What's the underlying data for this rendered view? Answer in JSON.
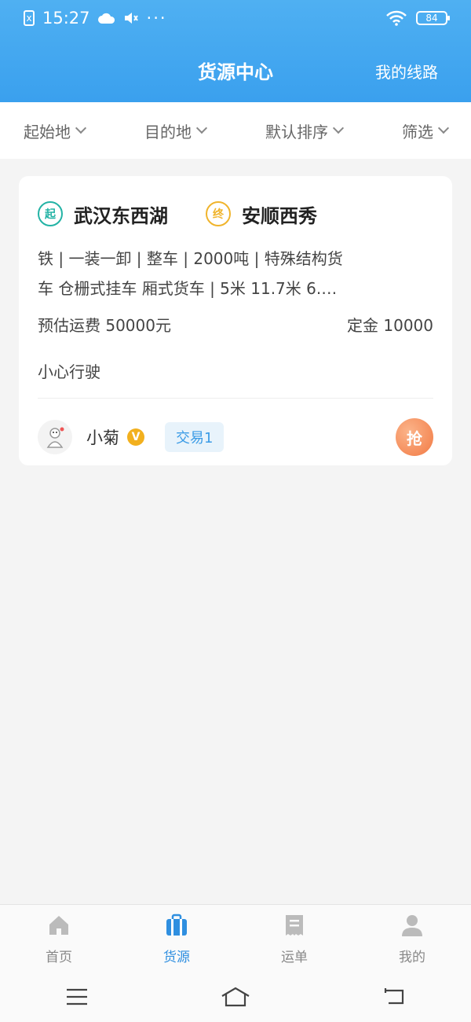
{
  "status_bar": {
    "time": "15:27",
    "sim_icon": "x",
    "dots": "···",
    "battery": "84"
  },
  "header": {
    "title": "货源中心",
    "right_link": "我的线路"
  },
  "filters": [
    {
      "label": "起始地"
    },
    {
      "label": "目的地"
    },
    {
      "label": "默认排序"
    },
    {
      "label": "筛选"
    }
  ],
  "card": {
    "start_badge": "起",
    "start_place": "武汉东西湖",
    "end_badge": "终",
    "end_place": "安顺西秀",
    "desc_line1": "铁 | 一装一卸 | 整车 | 2000吨 | 特殊结构货",
    "desc_line2": "车 仓栅式挂车 厢式货车 | 5米 11.7米 6.…",
    "freight": "预估运费 50000元",
    "deposit": "定金 10000",
    "remark": "小心行驶",
    "user_name": "小菊",
    "verify_badge": "V",
    "trade_count": "交易1",
    "grab_button": "抢"
  },
  "tabs": [
    {
      "label": "首页",
      "icon": "home-icon",
      "active": false
    },
    {
      "label": "货源",
      "icon": "cargo-icon",
      "active": true
    },
    {
      "label": "运单",
      "icon": "waybill-icon",
      "active": false
    },
    {
      "label": "我的",
      "icon": "profile-icon",
      "active": false
    }
  ],
  "colors": {
    "header": "#3aa0ee",
    "active_tab": "#2f8fe0",
    "start_pin": "#23b3a5",
    "end_pin": "#f0b42c",
    "grab_button": "#f27a44"
  }
}
